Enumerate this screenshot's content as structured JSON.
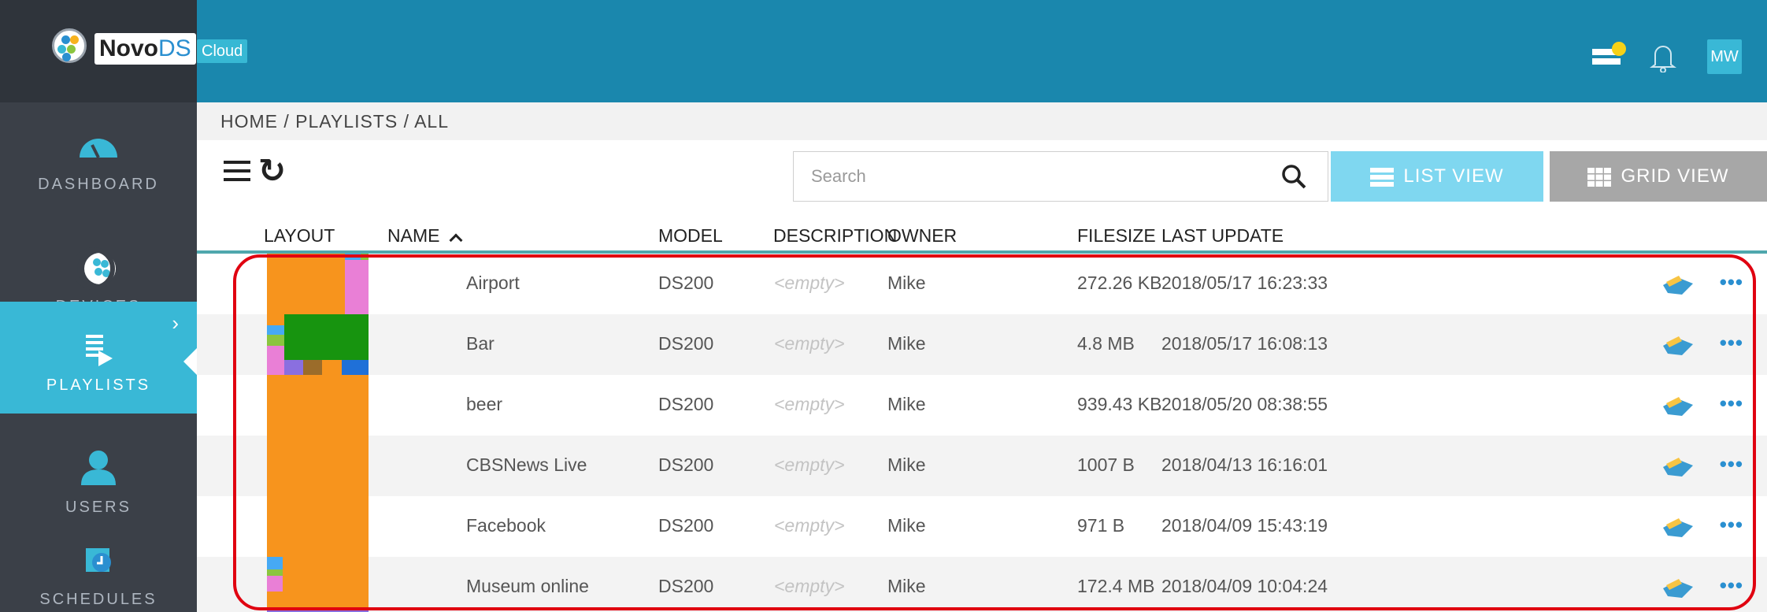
{
  "brand": {
    "logo_name": "Novo",
    "logo_suffix": "DS",
    "cloud_label": "Cloud"
  },
  "sidebar": {
    "items": [
      {
        "label": "DASHBOARD",
        "icon": "gauge-icon",
        "active": false
      },
      {
        "label": "DEVICES",
        "icon": "novo-device-icon",
        "active": false
      },
      {
        "label": "PLAYLISTS",
        "icon": "playlist-icon",
        "active": true
      },
      {
        "label": "USERS",
        "icon": "user-icon",
        "active": false
      },
      {
        "label": "SCHEDULES",
        "icon": "calendar-icon",
        "active": false
      }
    ]
  },
  "topbar": {
    "user_initials": "MW",
    "icons": [
      "notifications-tray-icon",
      "bell-icon"
    ]
  },
  "breadcrumb": "HOME / PLAYLISTS / ALL",
  "toolbar": {
    "search_placeholder": "Search",
    "list_view_label": "LIST VIEW",
    "grid_view_label": "GRID VIEW",
    "active_view": "list"
  },
  "table": {
    "columns": {
      "layout": "LAYOUT",
      "name": "NAME",
      "sort_indicator": "^",
      "model": "MODEL",
      "description": "DESCRIPTION",
      "owner": "OWNER",
      "filesize": "FILESIZE",
      "last_update": "LAST UPDATE"
    },
    "rows": [
      {
        "name": "Airport",
        "model": "DS200",
        "description": "<empty>",
        "owner": "Mike",
        "filesize": "272.26 KB",
        "last_update": "2018/05/17 16:23:33"
      },
      {
        "name": "Bar",
        "model": "DS200",
        "description": "<empty>",
        "owner": "Mike",
        "filesize": "4.8 MB",
        "last_update": "2018/05/17 16:08:13"
      },
      {
        "name": "beer",
        "model": "DS200",
        "description": "<empty>",
        "owner": "Mike",
        "filesize": "939.43 KB",
        "last_update": "2018/05/20 08:38:55"
      },
      {
        "name": "CBSNews Live",
        "model": "DS200",
        "description": "<empty>",
        "owner": "Mike",
        "filesize": "1007 B",
        "last_update": "2018/04/13 16:16:01"
      },
      {
        "name": "Facebook",
        "model": "DS200",
        "description": "<empty>",
        "owner": "Mike",
        "filesize": "971 B",
        "last_update": "2018/04/09 15:43:19"
      },
      {
        "name": "Museum online",
        "model": "DS200",
        "description": "<empty>",
        "owner": "Mike",
        "filesize": "172.4 MB",
        "last_update": "2018/04/09 10:04:24"
      }
    ],
    "row_actions": {
      "share_icon": "share-hand-icon",
      "more_icon": "more-dots-icon",
      "more_label": "•••"
    }
  },
  "colors": {
    "topbar": "#1a87ad",
    "sidebar": "#3b4048",
    "accent": "#39b8d6",
    "list_view": "#7fd7f0",
    "grid_view": "#a7a7a7",
    "layout_orange": "#f7941d",
    "highlight": "#e00010"
  }
}
